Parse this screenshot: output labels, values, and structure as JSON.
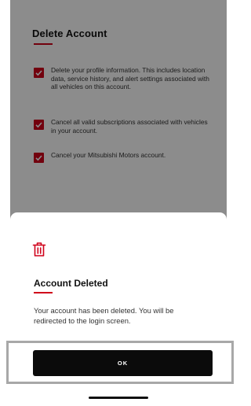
{
  "background_page": {
    "title": "Delete Account",
    "items": [
      {
        "text": "Delete your profile information. This includes location data, service history, and alert settings associated with all vehicles on this account."
      },
      {
        "text": "Cancel all valid subscriptions associated with vehicles in your account."
      },
      {
        "text": "Cancel your Mitsubishi Motors account."
      }
    ]
  },
  "dialog": {
    "icon": "trash-icon",
    "title": "Account Deleted",
    "message": "Your account has been deleted. You will be redirected to the login screen.",
    "ok_label": "OK"
  },
  "colors": {
    "accent": "#d0021b",
    "button": "#0b0b0b",
    "overlay": "rgba(0,0,0,0.45)"
  }
}
